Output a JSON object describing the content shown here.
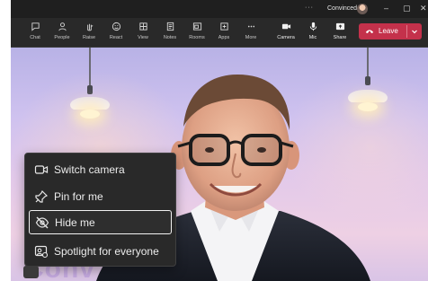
{
  "titlebar": {
    "more": "···",
    "user_name": "Convinced",
    "min": "–",
    "restore": "▢",
    "close": "✕"
  },
  "toolbar": {
    "items": [
      {
        "label": "Chat",
        "icon": "chat-icon"
      },
      {
        "label": "People",
        "icon": "people-icon"
      },
      {
        "label": "Raise",
        "icon": "raise-hand-icon"
      },
      {
        "label": "React",
        "icon": "react-icon"
      },
      {
        "label": "View",
        "icon": "view-icon"
      },
      {
        "label": "Notes",
        "icon": "notes-icon"
      },
      {
        "label": "Rooms",
        "icon": "rooms-icon"
      },
      {
        "label": "Apps",
        "icon": "apps-icon"
      },
      {
        "label": "More",
        "icon": "more-icon"
      },
      {
        "label": "Camera",
        "icon": "camera-icon"
      },
      {
        "label": "Mic",
        "icon": "mic-icon"
      },
      {
        "label": "Share",
        "icon": "share-icon"
      }
    ],
    "leave_label": "Leave"
  },
  "context_menu": {
    "items": [
      {
        "label": "Switch camera",
        "icon": "switch-camera-icon"
      },
      {
        "label": "Pin for me",
        "icon": "pin-icon"
      },
      {
        "label": "Hide me",
        "icon": "hide-eye-icon",
        "selected": true
      },
      {
        "label": "Spotlight for everyone",
        "icon": "spotlight-icon"
      }
    ]
  },
  "colors": {
    "leave_button": "#c4314b",
    "toolbar_bg": "#292929",
    "menu_bg": "#292929"
  }
}
